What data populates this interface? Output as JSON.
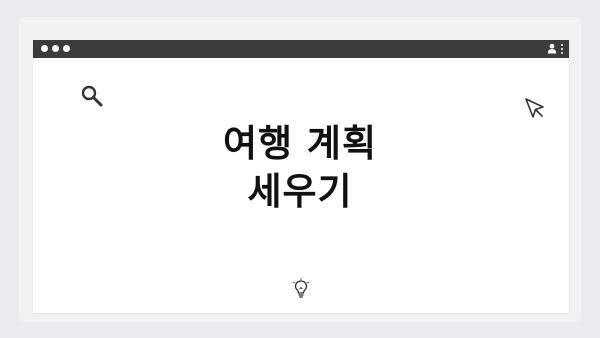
{
  "slide": {
    "title_line1": "여행 계획",
    "title_line2": "세우기"
  },
  "icons": {
    "search": "search-icon",
    "cursor": "cursor-arrow-icon",
    "idea": "lightbulb-icon",
    "user": "user-icon",
    "menu": "more-vert-icon"
  },
  "colors": {
    "background": "#e9ebee",
    "titlebar": "#3c3c3c",
    "window": "#ffffff",
    "text": "#111111"
  }
}
